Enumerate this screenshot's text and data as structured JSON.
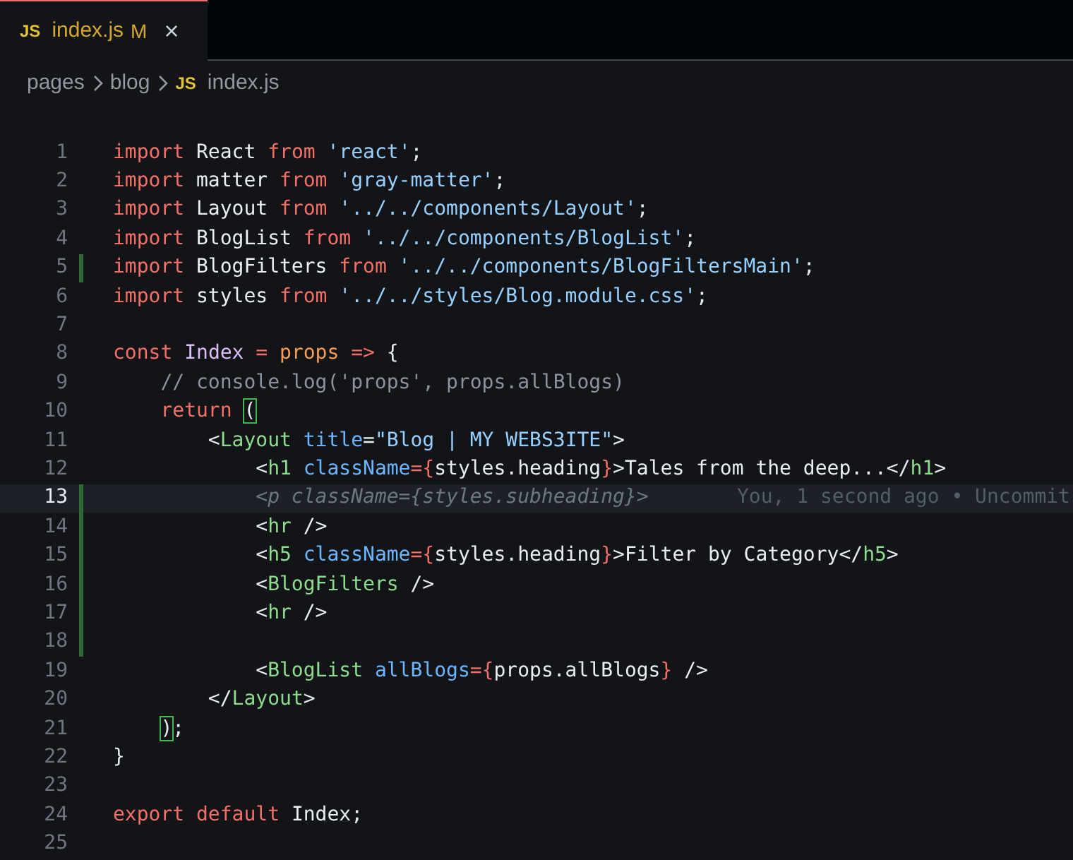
{
  "tabs": [
    {
      "icon": "JS",
      "label": "index.js",
      "badge": "M",
      "close": "×",
      "selected": true
    }
  ],
  "breadcrumb": [
    {
      "label": "pages"
    },
    {
      "label": "blog"
    },
    {
      "icon": "JS",
      "label": "index.js"
    }
  ],
  "lines": [
    {
      "number": "1",
      "modified": false,
      "current": false,
      "tokens": [
        {
          "kind": "keyword",
          "text": "import"
        },
        {
          "kind": "plain",
          "text": " React "
        },
        {
          "kind": "keyword",
          "text": "from"
        },
        {
          "kind": "string",
          "text": " 'react'"
        },
        {
          "kind": "plain",
          "text": ";"
        }
      ]
    },
    {
      "number": "2",
      "modified": false,
      "current": false,
      "tokens": [
        {
          "kind": "keyword",
          "text": "import"
        },
        {
          "kind": "plain",
          "text": " matter "
        },
        {
          "kind": "keyword",
          "text": "from"
        },
        {
          "kind": "string",
          "text": " 'gray-matter'"
        },
        {
          "kind": "plain",
          "text": ";"
        }
      ]
    },
    {
      "number": "3",
      "modified": false,
      "current": false,
      "tokens": [
        {
          "kind": "keyword",
          "text": "import"
        },
        {
          "kind": "plain",
          "text": " Layout "
        },
        {
          "kind": "keyword",
          "text": "from"
        },
        {
          "kind": "string",
          "text": " '../../components/Layout'"
        },
        {
          "kind": "plain",
          "text": ";"
        }
      ]
    },
    {
      "number": "4",
      "modified": false,
      "current": false,
      "tokens": [
        {
          "kind": "keyword",
          "text": "import"
        },
        {
          "kind": "plain",
          "text": " BlogList "
        },
        {
          "kind": "keyword",
          "text": "from"
        },
        {
          "kind": "string",
          "text": " '../../components/BlogList'"
        },
        {
          "kind": "plain",
          "text": ";"
        }
      ]
    },
    {
      "number": "5",
      "modified": true,
      "current": false,
      "tokens": [
        {
          "kind": "keyword",
          "text": "import"
        },
        {
          "kind": "plain",
          "text": " BlogFilters "
        },
        {
          "kind": "keyword",
          "text": "from"
        },
        {
          "kind": "string",
          "text": " '../../components/BlogFiltersMain'"
        },
        {
          "kind": "plain",
          "text": ";"
        }
      ]
    },
    {
      "number": "6",
      "modified": false,
      "current": false,
      "tokens": [
        {
          "kind": "keyword",
          "text": "import"
        },
        {
          "kind": "plain",
          "text": " styles "
        },
        {
          "kind": "keyword",
          "text": "from"
        },
        {
          "kind": "string",
          "text": " '../../styles/Blog.module.css'"
        },
        {
          "kind": "plain",
          "text": ";"
        }
      ]
    },
    {
      "number": "7",
      "modified": false,
      "current": false
    },
    {
      "number": "8",
      "modified": false,
      "current": false,
      "tokens": [
        {
          "kind": "keyword",
          "text": "const"
        },
        {
          "kind": "entity",
          "text": " Index"
        },
        {
          "kind": "keyword",
          "text": " ="
        },
        {
          "kind": "param",
          "text": " props"
        },
        {
          "kind": "keyword",
          "text": " =>"
        },
        {
          "kind": "plain",
          "text": " {"
        }
      ]
    },
    {
      "number": "9",
      "modified": false,
      "current": false,
      "tokens": [
        {
          "kind": "comment",
          "text": "    // console.log('props', props.allBlogs)"
        }
      ]
    },
    {
      "number": "10",
      "modified": false,
      "current": false,
      "tokens": [
        {
          "kind": "keyword",
          "text": "    return"
        },
        {
          "kind": "matched",
          "text": " ("
        }
      ]
    },
    {
      "number": "11",
      "modified": false,
      "current": false,
      "tokens": [
        {
          "kind": "plain",
          "text": "        <"
        },
        {
          "kind": "tag",
          "text": "Layout"
        },
        {
          "kind": "attr",
          "text": " title"
        },
        {
          "kind": "plain",
          "text": "="
        },
        {
          "kind": "string",
          "text": "\"Blog | MY WEBS3ITE\""
        },
        {
          "kind": "plain",
          "text": ">"
        }
      ]
    },
    {
      "number": "12",
      "modified": false,
      "current": false,
      "tokens": [
        {
          "kind": "plain",
          "text": "            <"
        },
        {
          "kind": "tag",
          "text": "h1"
        },
        {
          "kind": "attr",
          "text": " className"
        },
        {
          "kind": "keyword",
          "text": "={"
        },
        {
          "kind": "plain",
          "text": "styles.heading"
        },
        {
          "kind": "keyword",
          "text": "}"
        },
        {
          "kind": "plain",
          "text": ">Tales from the deep...</"
        },
        {
          "kind": "tag",
          "text": "h1"
        },
        {
          "kind": "plain",
          "text": ">"
        }
      ]
    },
    {
      "number": "13",
      "modified": true,
      "current": true,
      "tokens": [
        {
          "kind": "ghost",
          "text": "            <p className={styles.subheading}>"
        }
      ],
      "blame": "You, 1 second ago • Uncommit"
    },
    {
      "number": "14",
      "modified": true,
      "current": false,
      "tokens": [
        {
          "kind": "plain",
          "text": "            <"
        },
        {
          "kind": "tag",
          "text": "hr"
        },
        {
          "kind": "plain",
          "text": " />"
        }
      ]
    },
    {
      "number": "15",
      "modified": true,
      "current": false,
      "tokens": [
        {
          "kind": "plain",
          "text": "            <"
        },
        {
          "kind": "tag",
          "text": "h5"
        },
        {
          "kind": "attr",
          "text": " className"
        },
        {
          "kind": "keyword",
          "text": "={"
        },
        {
          "kind": "plain",
          "text": "styles.heading"
        },
        {
          "kind": "keyword",
          "text": "}"
        },
        {
          "kind": "plain",
          "text": ">Filter by Category</"
        },
        {
          "kind": "tag",
          "text": "h5"
        },
        {
          "kind": "plain",
          "text": ">"
        }
      ]
    },
    {
      "number": "16",
      "modified": true,
      "current": false,
      "tokens": [
        {
          "kind": "plain",
          "text": "            <"
        },
        {
          "kind": "tag",
          "text": "BlogFilters"
        },
        {
          "kind": "plain",
          "text": " />"
        }
      ]
    },
    {
      "number": "17",
      "modified": true,
      "current": false,
      "tokens": [
        {
          "kind": "plain",
          "text": "            <"
        },
        {
          "kind": "tag",
          "text": "hr"
        },
        {
          "kind": "plain",
          "text": " />"
        }
      ]
    },
    {
      "number": "18",
      "modified": true,
      "current": false
    },
    {
      "number": "19",
      "modified": false,
      "current": false,
      "tokens": [
        {
          "kind": "plain",
          "text": "            <"
        },
        {
          "kind": "tag",
          "text": "BlogList"
        },
        {
          "kind": "attr",
          "text": " allBlogs"
        },
        {
          "kind": "keyword",
          "text": "={"
        },
        {
          "kind": "plain",
          "text": "props.allBlogs"
        },
        {
          "kind": "keyword",
          "text": "}"
        },
        {
          "kind": "plain",
          "text": " />"
        }
      ]
    },
    {
      "number": "20",
      "modified": false,
      "current": false,
      "tokens": [
        {
          "kind": "plain",
          "text": "        </"
        },
        {
          "kind": "tag",
          "text": "Layout"
        },
        {
          "kind": "plain",
          "text": ">"
        }
      ]
    },
    {
      "number": "21",
      "modified": false,
      "current": false,
      "tokens": [
        {
          "kind": "matched",
          "text": "    )"
        },
        {
          "kind": "plain",
          "text": ";"
        }
      ]
    },
    {
      "number": "22",
      "modified": false,
      "current": false,
      "tokens": [
        {
          "kind": "plain",
          "text": "}"
        }
      ]
    },
    {
      "number": "23",
      "modified": false,
      "current": false
    },
    {
      "number": "24",
      "modified": false,
      "current": false,
      "tokens": [
        {
          "kind": "keyword",
          "text": "export"
        },
        {
          "kind": "keyword",
          "text": " default"
        },
        {
          "kind": "plain",
          "text": " Index;"
        }
      ]
    },
    {
      "number": "25",
      "modified": false,
      "current": false
    }
  ]
}
